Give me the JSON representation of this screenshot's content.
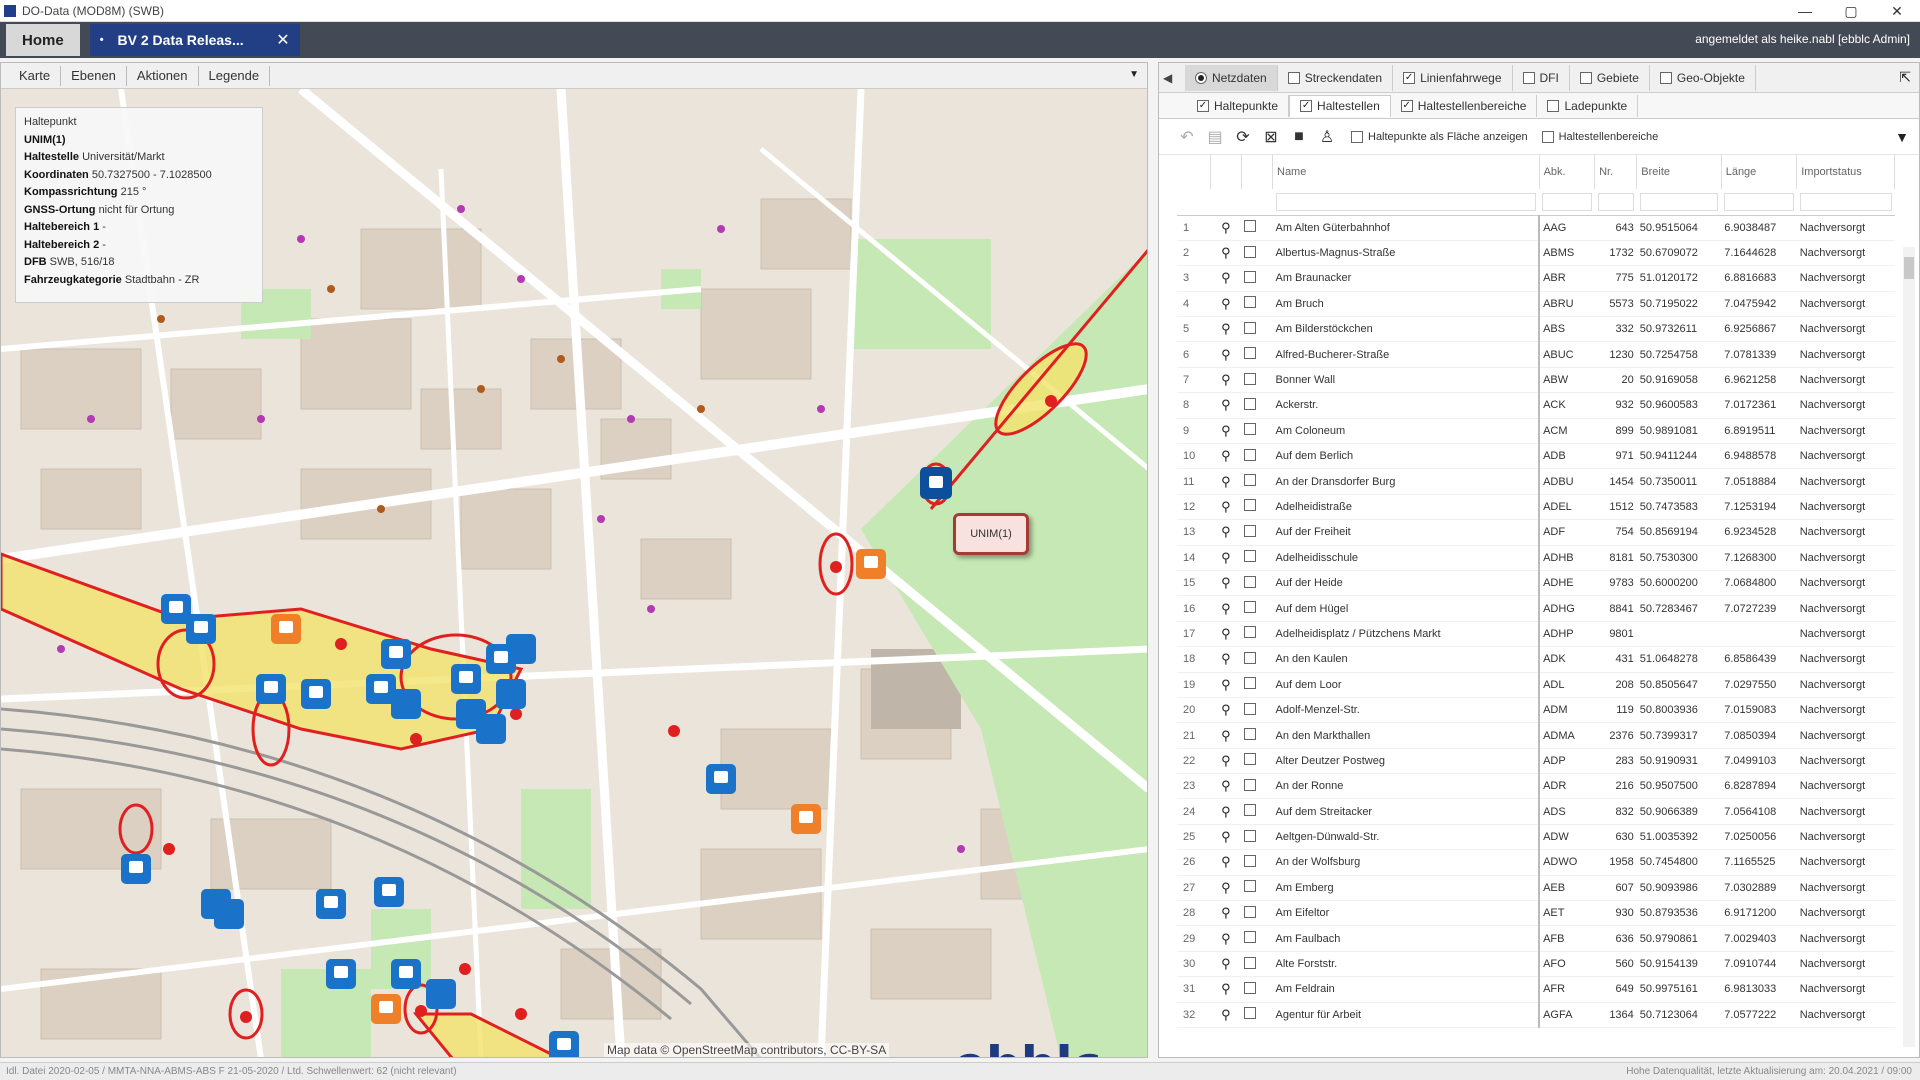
{
  "window": {
    "title": "DO-Data (MOD8M) (SWB)",
    "controls": [
      "—",
      "▢",
      "✕"
    ]
  },
  "tabs": {
    "home": "Home",
    "active": "BV 2 Data Releas...",
    "active_star": "•",
    "close": "✕"
  },
  "user": "angemeldet als heike.nabl [ebblc Admin]",
  "map_toolbar": {
    "items": [
      "Karte",
      "Ebenen",
      "Aktionen",
      "Legende"
    ]
  },
  "info_box": {
    "title": "Haltepunkt",
    "lines": [
      {
        "label": "UNIM(1)",
        "value": ""
      },
      {
        "label": "Haltestelle",
        "value": "Universität/Markt"
      },
      {
        "label": "Koordinaten",
        "value": "50.7327500 - 7.1028500"
      },
      {
        "label": "Kompassrichtung",
        "value": "215 °"
      },
      {
        "label": "GNSS-Ortung",
        "value": "nicht für Ortung"
      },
      {
        "label": "Haltebereich 1",
        "value": "-"
      },
      {
        "label": "Haltebereich 2",
        "value": "-"
      },
      {
        "label": "DFB",
        "value": "SWB, 516/18"
      },
      {
        "label": "Fahrzeugkategorie",
        "value": "Stadtbahn - ZR"
      }
    ]
  },
  "map_tooltip": "UNIM(1)",
  "map_attribution": "Map data © OpenStreetMap contributors, CC-BY-SA",
  "logo_text": "ebblc",
  "right_tabs": [
    {
      "label": "Netzdaten",
      "kind": "radio",
      "checked": true
    },
    {
      "label": "Streckendaten",
      "kind": "check",
      "checked": false
    },
    {
      "label": "Linienfahrwege",
      "kind": "check",
      "checked": true
    },
    {
      "label": "DFI",
      "kind": "check",
      "checked": false
    },
    {
      "label": "Gebiete",
      "kind": "check",
      "checked": false
    },
    {
      "label": "Geo-Objekte",
      "kind": "check",
      "checked": false
    }
  ],
  "sub_tabs": [
    {
      "label": "Haltepunkte",
      "checked": true
    },
    {
      "label": "Haltestellen",
      "checked": true
    },
    {
      "label": "Haltestellenbereiche",
      "checked": true
    },
    {
      "label": "Ladepunkte",
      "checked": false
    }
  ],
  "toolbar_options": [
    "Haltepunkte als Fläche anzeigen",
    "Haltestellenbereiche"
  ],
  "table": {
    "headers": [
      "",
      "",
      "",
      "Name",
      "Abk.",
      "Nr.",
      "Breite",
      "Länge",
      "Importstatus"
    ],
    "rows": [
      [
        "1",
        "Am Alten Güterbahnhof",
        "AAG",
        "643",
        "50.9515064",
        "6.9038487",
        "Nachversorgt"
      ],
      [
        "2",
        "Albertus-Magnus-Straße",
        "ABMS",
        "1732",
        "50.6709072",
        "7.1644628",
        "Nachversorgt"
      ],
      [
        "3",
        "Am Braunacker",
        "ABR",
        "775",
        "51.0120172",
        "6.8816683",
        "Nachversorgt"
      ],
      [
        "4",
        "Am Bruch",
        "ABRU",
        "5573",
        "50.7195022",
        "7.0475942",
        "Nachversorgt"
      ],
      [
        "5",
        "Am Bilderstöckchen",
        "ABS",
        "332",
        "50.9732611",
        "6.9256867",
        "Nachversorgt"
      ],
      [
        "6",
        "Alfred-Bucherer-Straße",
        "ABUC",
        "1230",
        "50.7254758",
        "7.0781339",
        "Nachversorgt"
      ],
      [
        "7",
        "Bonner Wall",
        "ABW",
        "20",
        "50.9169058",
        "6.9621258",
        "Nachversorgt"
      ],
      [
        "8",
        "Ackerstr.",
        "ACK",
        "932",
        "50.9600583",
        "7.0172361",
        "Nachversorgt"
      ],
      [
        "9",
        "Am Coloneum",
        "ACM",
        "899",
        "50.9891081",
        "6.8919511",
        "Nachversorgt"
      ],
      [
        "10",
        "Auf dem Berlich",
        "ADB",
        "971",
        "50.9411244",
        "6.9488578",
        "Nachversorgt"
      ],
      [
        "11",
        "An der Dransdorfer Burg",
        "ADBU",
        "1454",
        "50.7350011",
        "7.0518884",
        "Nachversorgt"
      ],
      [
        "12",
        "Adelheidistraße",
        "ADEL",
        "1512",
        "50.7473583",
        "7.1253194",
        "Nachversorgt"
      ],
      [
        "13",
        "Auf der Freiheit",
        "ADF",
        "754",
        "50.8569194",
        "6.9234528",
        "Nachversorgt"
      ],
      [
        "14",
        "Adelheidisschule",
        "ADHB",
        "8181",
        "50.7530300",
        "7.1268300",
        "Nachversorgt"
      ],
      [
        "15",
        "Auf der Heide",
        "ADHE",
        "9783",
        "50.6000200",
        "7.0684800",
        "Nachversorgt"
      ],
      [
        "16",
        "Auf dem Hügel",
        "ADHG",
        "8841",
        "50.7283467",
        "7.0727239",
        "Nachversorgt"
      ],
      [
        "17",
        "Adelheidisplatz / Pützchens Markt",
        "ADHP",
        "9801",
        "",
        "",
        "Nachversorgt"
      ],
      [
        "18",
        "An den Kaulen",
        "ADK",
        "431",
        "51.0648278",
        "6.8586439",
        "Nachversorgt"
      ],
      [
        "19",
        "Auf dem Loor",
        "ADL",
        "208",
        "50.8505647",
        "7.0297550",
        "Nachversorgt"
      ],
      [
        "20",
        "Adolf-Menzel-Str.",
        "ADM",
        "119",
        "50.8003936",
        "7.0159083",
        "Nachversorgt"
      ],
      [
        "21",
        "An den Markthallen",
        "ADMA",
        "2376",
        "50.7399317",
        "7.0850394",
        "Nachversorgt"
      ],
      [
        "22",
        "Alter Deutzer Postweg",
        "ADP",
        "283",
        "50.9190931",
        "7.0499103",
        "Nachversorgt"
      ],
      [
        "23",
        "An der Ronne",
        "ADR",
        "216",
        "50.9507500",
        "6.8287894",
        "Nachversorgt"
      ],
      [
        "24",
        "Auf dem Streitacker",
        "ADS",
        "832",
        "50.9066389",
        "7.0564108",
        "Nachversorgt"
      ],
      [
        "25",
        "Aeltgen-Dünwald-Str.",
        "ADW",
        "630",
        "51.0035392",
        "7.0250056",
        "Nachversorgt"
      ],
      [
        "26",
        "An der Wolfsburg",
        "ADWO",
        "1958",
        "50.7454800",
        "7.1165525",
        "Nachversorgt"
      ],
      [
        "27",
        "Am Emberg",
        "AEB",
        "607",
        "50.9093986",
        "7.0302889",
        "Nachversorgt"
      ],
      [
        "28",
        "Am Eifeltor",
        "AET",
        "930",
        "50.8793536",
        "6.9171200",
        "Nachversorgt"
      ],
      [
        "29",
        "Am Faulbach",
        "AFB",
        "636",
        "50.9790861",
        "7.0029403",
        "Nachversorgt"
      ],
      [
        "30",
        "Alte Forststr.",
        "AFO",
        "560",
        "50.9154139",
        "7.0910744",
        "Nachversorgt"
      ],
      [
        "31",
        "Am Feldrain",
        "AFR",
        "649",
        "50.9975161",
        "6.9813033",
        "Nachversorgt"
      ],
      [
        "32",
        "Agentur für Arbeit",
        "AGFA",
        "1364",
        "50.7123064",
        "7.0577222",
        "Nachversorgt"
      ]
    ]
  },
  "statusbar": {
    "left": "Idl. Datei 2020-02-05 / MMTA-NNA-ABMS-ABS F 21-05-2020 / Ltd. Schwellenwert: 62 (nicht relevant)",
    "right": "Hohe Datenqualität, letzte Aktualisierung am: 20.04.2021 / 09:00"
  },
  "colors": {
    "tab_active": "#223f85",
    "tabbar": "#444a55",
    "route_red": "#e02020",
    "area_yellow": "#f3e26b",
    "stop_blue": "#1a73c8",
    "stop_orange": "#f07f2a",
    "logo": "#1e3b82"
  },
  "icons": {
    "lookup": "magnifier-icon",
    "undo": "undo-icon",
    "save": "save-icon",
    "refresh": "refresh-icon",
    "filter": "filter-icon",
    "pin": "pin-icon"
  }
}
